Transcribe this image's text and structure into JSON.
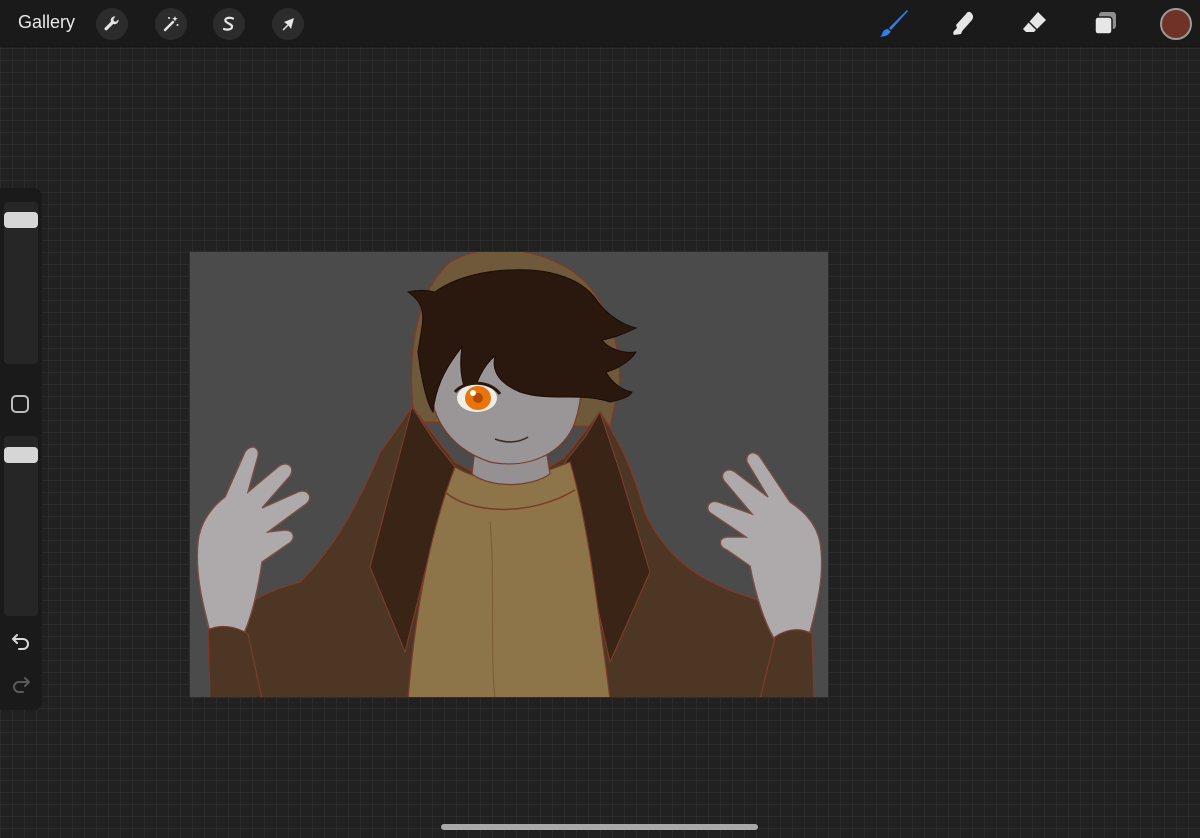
{
  "topbar": {
    "gallery_label": "Gallery",
    "left_tools": [
      {
        "name": "actions",
        "icon": "wrench-icon"
      },
      {
        "name": "adjustments",
        "icon": "magic-wand-icon"
      },
      {
        "name": "selection",
        "icon": "selection-s-icon"
      },
      {
        "name": "transform",
        "icon": "arrow-cursor-icon"
      }
    ],
    "right_tools": [
      {
        "name": "paint-brush",
        "icon": "brush-icon",
        "active": true
      },
      {
        "name": "smudge",
        "icon": "smudge-finger-icon",
        "active": false
      },
      {
        "name": "eraser",
        "icon": "eraser-icon",
        "active": false
      },
      {
        "name": "layers",
        "icon": "layers-icon",
        "active": false
      }
    ],
    "current_color": "#6e3326",
    "active_tool_color": "#2f7ff0"
  },
  "sidebar": {
    "brush_size_level": 0.08,
    "opacity_level": 0.08,
    "modify_icon": "square-modify-icon",
    "undo_icon": "undo-icon",
    "redo_icon": "redo-icon",
    "redo_enabled": false
  },
  "canvas": {
    "background_color": "#4b4b4b",
    "artwork": "character-illustration"
  }
}
